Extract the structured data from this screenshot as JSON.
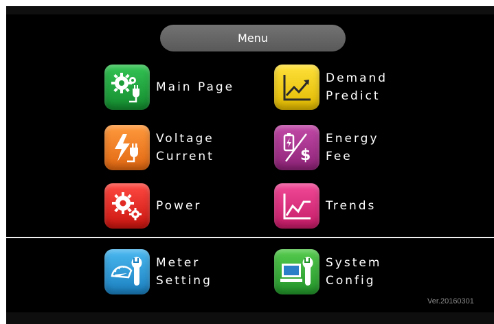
{
  "menu": {
    "title": "Menu"
  },
  "items": {
    "main_page": {
      "line1": "Main Page",
      "icon": "gears-plug-icon",
      "color": "#1e9e3a"
    },
    "demand_predict": {
      "line1": "Demand",
      "line2": "Predict",
      "icon": "rising-chart-icon",
      "color": "#f2cd00"
    },
    "voltage_current": {
      "line1": "Voltage",
      "line2": "Current",
      "icon": "lightning-plug-icon",
      "color": "#f07a1e"
    },
    "energy_fee": {
      "line1": "Energy",
      "line2": "Fee",
      "icon": "battery-dollar-icon",
      "color": "#a8308e"
    },
    "power": {
      "line1": "Power",
      "icon": "gears-icon",
      "color": "#e22a24"
    },
    "trends": {
      "line1": "Trends",
      "icon": "trend-chart-icon",
      "color": "#e0307e"
    },
    "meter_setting": {
      "line1": "Meter",
      "line2": "Setting",
      "icon": "meter-wrench-icon",
      "color": "#2a9ad8"
    },
    "system_config": {
      "line1": "System",
      "line2": "Config",
      "icon": "monitor-wrench-icon",
      "color": "#3cae3a"
    }
  },
  "version": "Ver.20160301"
}
